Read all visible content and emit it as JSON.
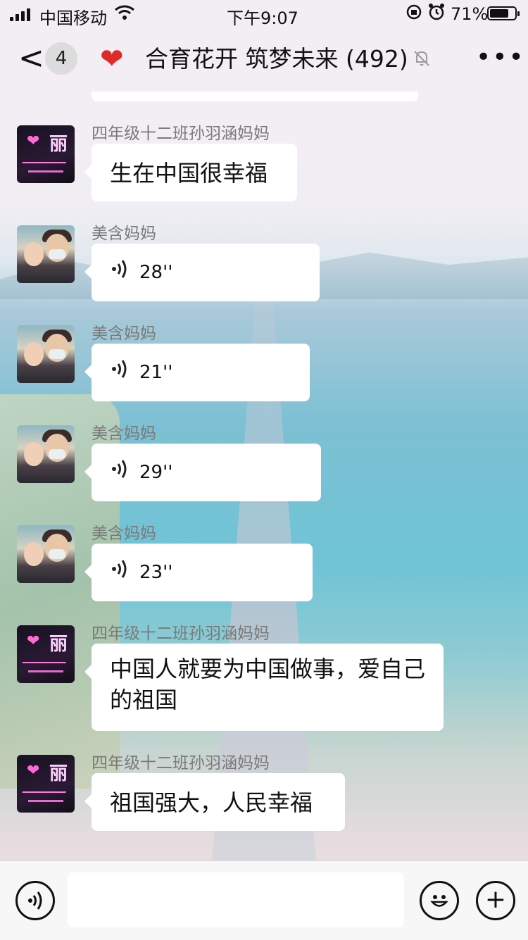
{
  "status_bar": {
    "carrier": "中国移动",
    "time": "下午9:07",
    "battery_percent": "71%",
    "wifi_icon": "wifi-icon",
    "lock_icon": "rotation-lock-icon",
    "alarm_icon": "alarm-icon",
    "battery_level": 0.71
  },
  "nav": {
    "back_glyph": "<",
    "unread_count": "4",
    "heart_glyph": "❤",
    "title": "合育花开 筑梦未来 (492)",
    "mute_glyph": "🔕",
    "more_glyph": "•••"
  },
  "messages": [
    {
      "sender": "四年级十二班孙羽涵妈妈",
      "type": "text",
      "text": "生在中国很幸福",
      "avatar": "neon-avatar"
    },
    {
      "sender": "美含妈妈",
      "type": "voice",
      "duration": "28''",
      "avatar": "photo-avatar"
    },
    {
      "sender": "美含妈妈",
      "type": "voice",
      "duration": "21''",
      "avatar": "photo-avatar"
    },
    {
      "sender": "美含妈妈",
      "type": "voice",
      "duration": "29''",
      "avatar": "photo-avatar"
    },
    {
      "sender": "美含妈妈",
      "type": "voice",
      "duration": "23''",
      "avatar": "photo-avatar"
    },
    {
      "sender": "四年级十二班孙羽涵妈妈",
      "type": "text",
      "text": "中国人就要为中国做事，爱自己的祖国",
      "avatar": "neon-avatar"
    },
    {
      "sender": "四年级十二班孙羽涵妈妈",
      "type": "text",
      "text": "祖国强大，人民幸福",
      "avatar": "neon-avatar"
    }
  ],
  "avatar_text": {
    "neon_char": "丽"
  },
  "input_bar": {
    "voice_glyph": "🔊",
    "emoji_glyph": "☺",
    "plus_glyph": "+"
  },
  "colors": {
    "heart": "#e02929",
    "bubble": "#ffffff",
    "sender_name": "#7a7a7a"
  }
}
